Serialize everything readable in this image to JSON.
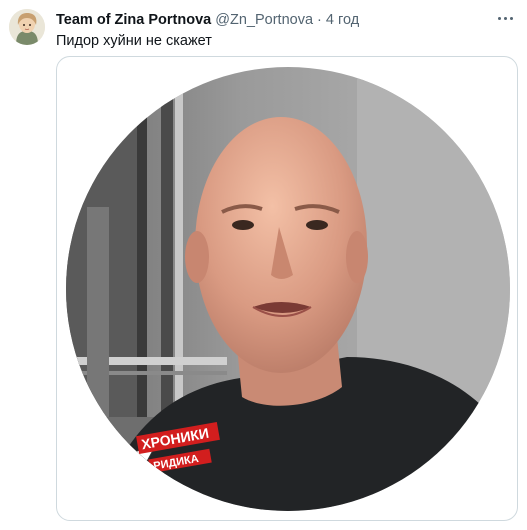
{
  "tweet": {
    "author_name": "Team  of Zina Portnova",
    "author_handle": "@Zn_Portnova",
    "separator": "·",
    "timestamp": "4 год",
    "text": "Пидор хуйни не скажет"
  },
  "media": {
    "watermark_line1": "ХРОНИКИ",
    "watermark_line2": "РИДИКА"
  },
  "icons": {
    "more": "more-dots-icon",
    "watermark": "paper-plane-icon"
  },
  "colors": {
    "name": "#0f1419",
    "secondary": "#536471",
    "border": "#cfd9de",
    "watermark_red": "#d21e1e"
  }
}
